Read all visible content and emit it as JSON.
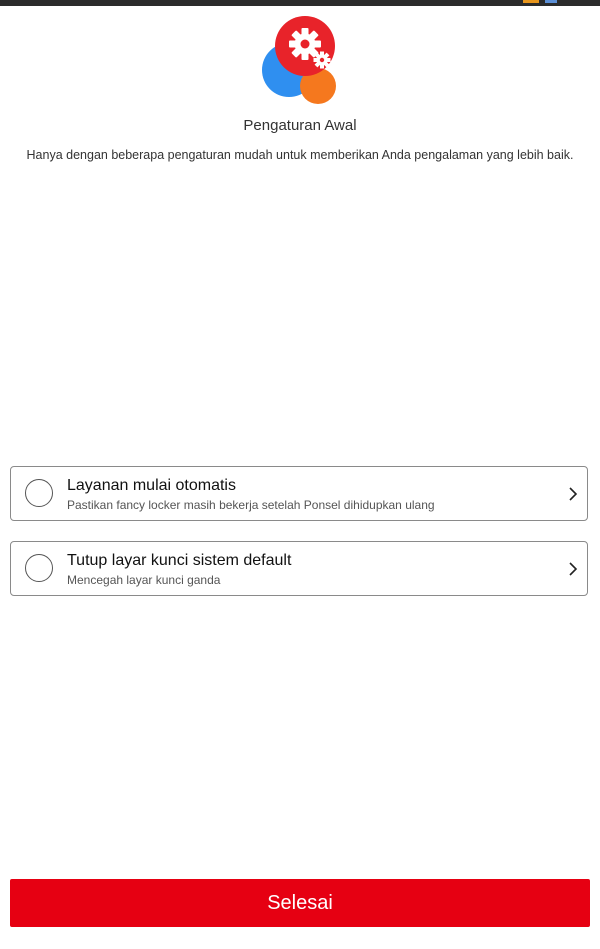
{
  "status_bar": {
    "icons": [
      "notification-icon",
      "battery-icon"
    ],
    "background_color": "#2b2b2b"
  },
  "header": {
    "logo_icon": "settings-gear-icon",
    "logo_colors": [
      "#e8232a",
      "#2f8ff0",
      "#f5781e"
    ],
    "title": "Pengaturan Awal",
    "subtitle": "Hanya dengan beberapa pengaturan mudah untuk memberikan Anda pengalaman yang lebih baik."
  },
  "options": [
    {
      "title": "Layanan mulai otomatis",
      "description": "Pastikan fancy locker masih bekerja setelah Ponsel dihidupkan ulang",
      "checked": false
    },
    {
      "title": "Tutup layar kunci sistem default",
      "description": "Mencegah layar kunci ganda",
      "checked": false
    }
  ],
  "footer": {
    "done_label": "Selesai",
    "done_color": "#e60012"
  }
}
